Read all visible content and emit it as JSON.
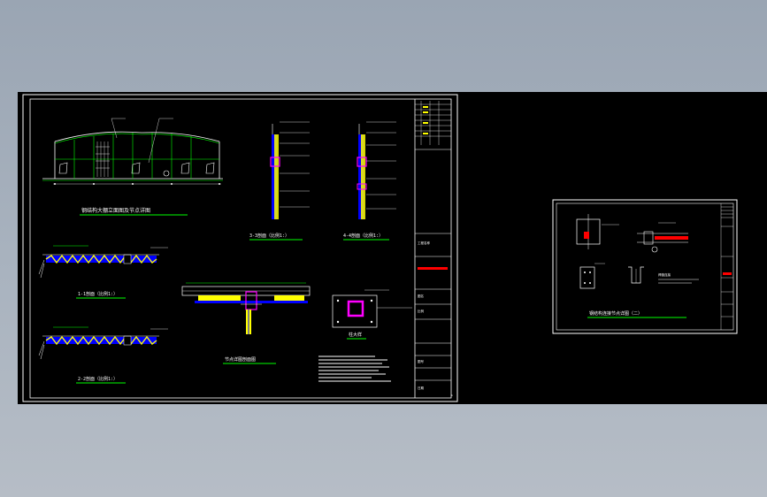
{
  "colors": {
    "background": "#a3adb9",
    "model_space": "#000000",
    "border": "#ffffff",
    "title_green": "#00ff00",
    "member_yellow": "#ffff00",
    "member_blue": "#0000ff",
    "member_magenta": "#ff00ff",
    "accent_red": "#ff0000",
    "accent_cyan": "#00ffff"
  },
  "sheet1": {
    "elevation_title": "钢结构大棚立面图及节点详图",
    "section_1": "1-1剖面（比例1:）",
    "section_2": "2-2剖面（比例1:）",
    "section_3": "3-3剖面（比例1:）",
    "section_4": "4-4剖面（比例1:）",
    "joint_title": "节点详图剖面图",
    "column_title": "柱大样",
    "title_block": {
      "project": "工程名称",
      "drawing": "图名",
      "scale": "比例",
      "number": "图号",
      "date": "日期"
    }
  },
  "sheet2": {
    "title": "钢结构连接节点详图（二）",
    "note": "焊缝连接"
  }
}
